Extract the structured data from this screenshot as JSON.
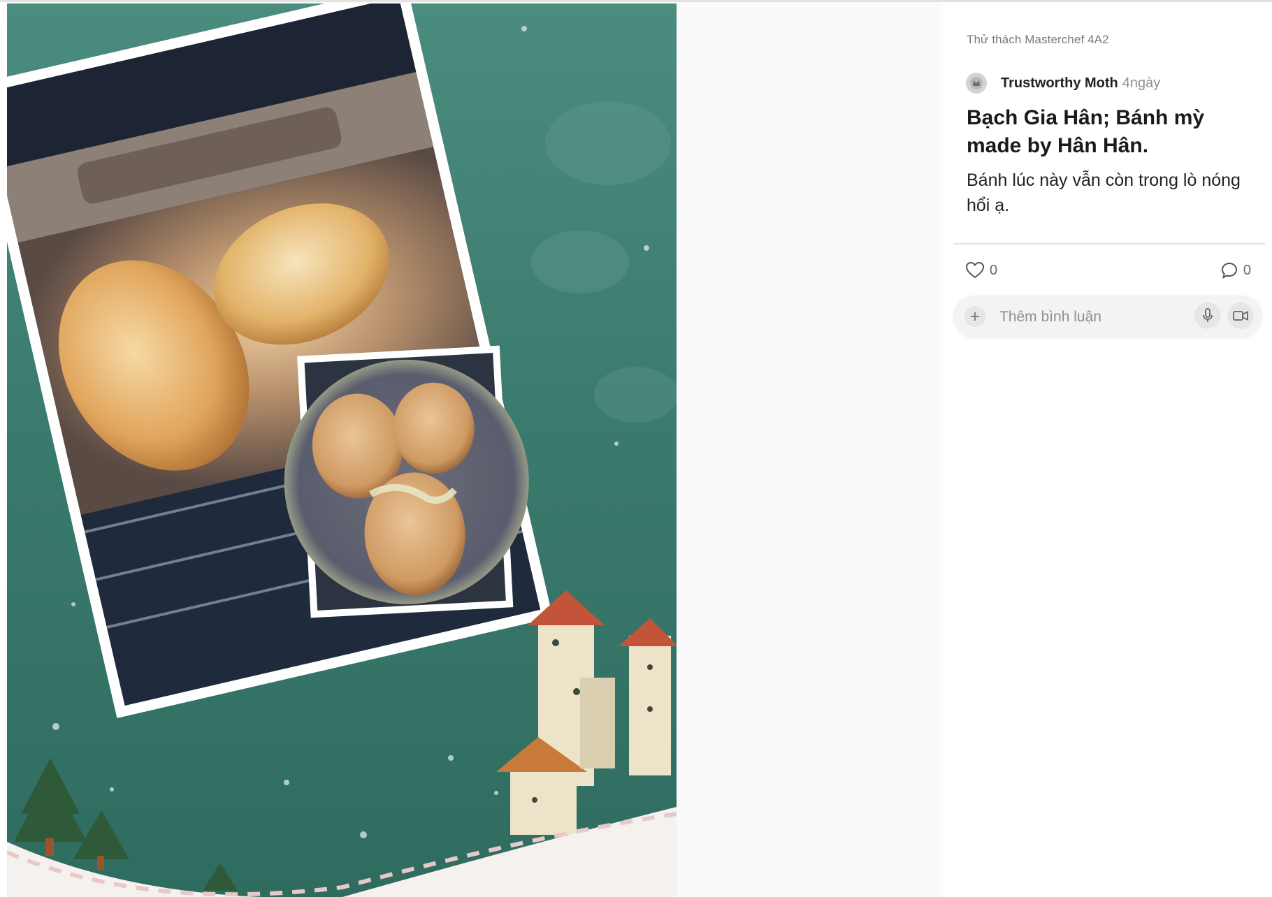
{
  "post": {
    "group_name": "Thử thách Masterchef 4A2",
    "author_name": "Trustworthy Moth",
    "time_ago": "4ngày",
    "title": "Bạch Gia Hân; Bánh mỳ made by Hân Hân.",
    "body": "Bánh lúc này vẫn còn trong lò nóng hổi ạ."
  },
  "reactions": {
    "like_count": "0",
    "comment_count": "0",
    "like_icon": "heart-icon",
    "comment_icon": "speech-bubble-icon"
  },
  "comment_box": {
    "placeholder": "Thêm bình luận",
    "add_icon": "plus-icon",
    "mic_icon": "microphone-icon",
    "video_icon": "video-camera-icon"
  },
  "image": {
    "description_icon": "post-photo",
    "background_color": "#3c7f70"
  }
}
